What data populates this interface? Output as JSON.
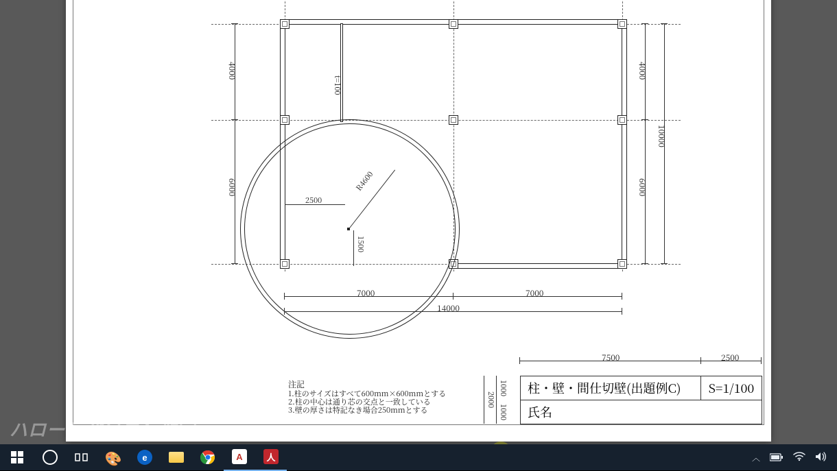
{
  "drawing": {
    "dimensions": {
      "left_upper": "4000",
      "left_lower": "6000",
      "right_upper": "4000",
      "right_lower": "6000",
      "right_total": "10000",
      "bottom_left": "7000",
      "bottom_right": "7000",
      "bottom_total": "14000",
      "inner_2500": "2500",
      "inner_1500": "1500",
      "radius": "R4600",
      "wall_t": "t=100"
    },
    "notes": {
      "heading": "注記",
      "n1": "1.柱のサイズはすべて600mm×600mmとする",
      "n2": "2.柱の中心は通り芯の交点と一致している",
      "n3": "3.壁の厚さは特記なき場合250mmとする"
    },
    "titleblock": {
      "top_dim_left": "7500",
      "top_dim_right": "2500",
      "left_dim_upper": "1000",
      "left_dim_lower": "1000",
      "left_dim_total": "2000",
      "title": "柱・壁・間仕切壁(出題例C)",
      "scale": "S=1/100",
      "name_label": "氏名"
    }
  },
  "taskbar": {
    "apps": {
      "autocad_letter": "A",
      "acrobat_letter": "人"
    }
  },
  "watermark": "ハロー！パソコン教室"
}
